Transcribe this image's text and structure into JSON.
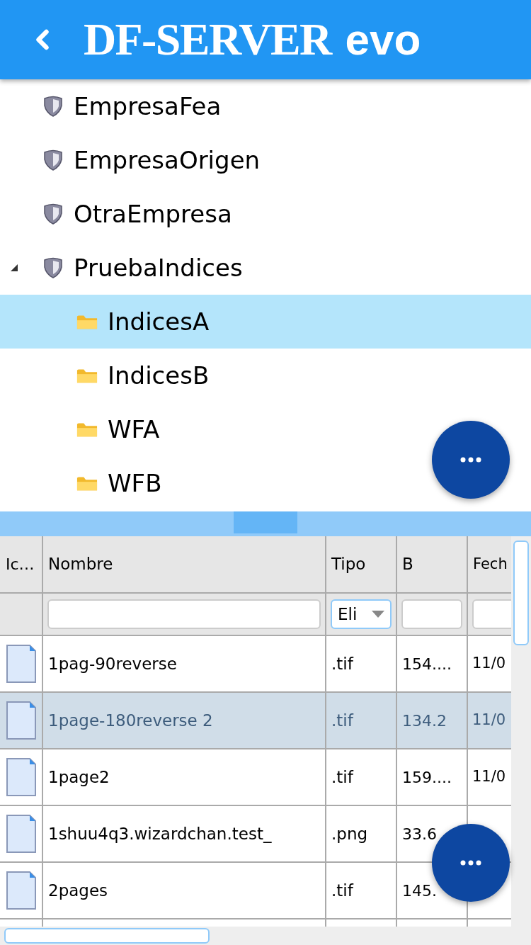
{
  "header": {
    "logo_main": "DF-SERVER",
    "logo_suffix": "evo"
  },
  "tree": [
    {
      "label": "EmpresaFea",
      "kind": "company",
      "expanded": false,
      "selected": false
    },
    {
      "label": "EmpresaOrigen",
      "kind": "company",
      "expanded": false,
      "selected": false
    },
    {
      "label": "OtraEmpresa",
      "kind": "company",
      "expanded": false,
      "selected": false
    },
    {
      "label": "PruebaIndices",
      "kind": "company",
      "expanded": true,
      "selected": false,
      "children": [
        {
          "label": "IndicesA",
          "kind": "folder",
          "expanded": false,
          "selected": true
        },
        {
          "label": "IndicesB",
          "kind": "folder",
          "expanded": false,
          "selected": false
        },
        {
          "label": "WFA",
          "kind": "folder",
          "expanded": false,
          "selected": false
        },
        {
          "label": "WFB",
          "kind": "folder",
          "expanded": false,
          "selected": false
        }
      ]
    }
  ],
  "table": {
    "columns": [
      "Ic…",
      "Nombre",
      "Tipo",
      "B",
      "Fech"
    ],
    "filters": {
      "tipo_value": "Eli"
    },
    "rows": [
      {
        "name": "1pag-90reverse",
        "type": ".tif",
        "size": "154....",
        "date": "11/0",
        "selected": false
      },
      {
        "name": "1page-180reverse 2",
        "type": ".tif",
        "size": "134.2",
        "date": "11/0",
        "selected": true
      },
      {
        "name": "1page2",
        "type": ".tif",
        "size": "159....",
        "date": "11/0",
        "selected": false
      },
      {
        "name": "1shuu4q3.wizardchan.test_",
        "type": ".png",
        "size": "33.6",
        "selected": false
      },
      {
        "name": "2pages",
        "type": ".tif",
        "size": "145.",
        "selected": false
      }
    ]
  }
}
